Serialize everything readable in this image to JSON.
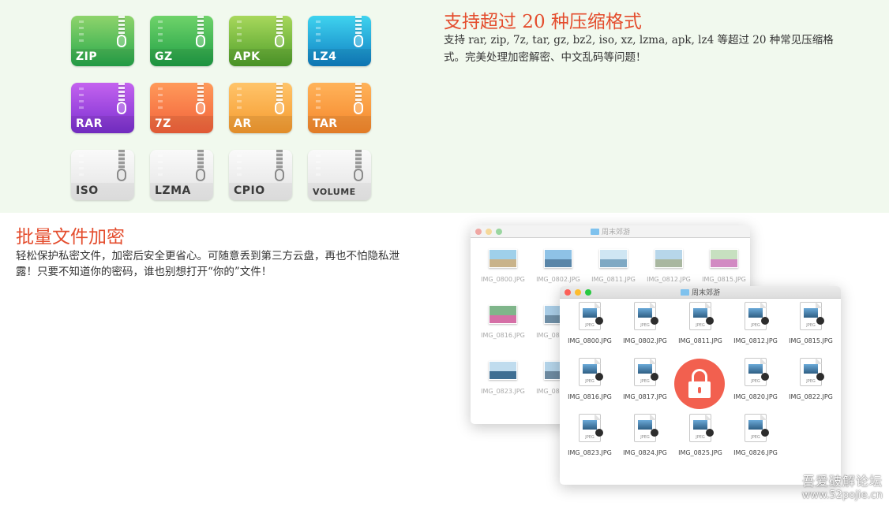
{
  "formats_section": {
    "title": "支持超过 20 种压缩格式",
    "description_line1": "支持 rar, zip, 7z, tar, gz, bz2, iso, xz, lzma, apk, lz4 等超过 20 种常见压缩格",
    "description_line2": "式。完美处理加密解密、中文乱码等问题！"
  },
  "format_icons": [
    {
      "label": "ZIP",
      "color_top": "#8fd46c",
      "color_bottom": "#26a84b"
    },
    {
      "label": "GZ",
      "color_top": "#6fd36a",
      "color_bottom": "#1f9f45"
    },
    {
      "label": "APK",
      "color_top": "#a8d85c",
      "color_bottom": "#4f9f2a"
    },
    {
      "label": "LZ4",
      "color_top": "#3fd3ef",
      "color_bottom": "#0f7fc2"
    },
    {
      "label": "RAR",
      "color_top": "#c463ef",
      "color_bottom": "#7a2fd0"
    },
    {
      "label": "7Z",
      "color_top": "#ff9a5a",
      "color_bottom": "#f2613a"
    },
    {
      "label": "AR",
      "color_top": "#ffc46a",
      "color_bottom": "#f59a2e"
    },
    {
      "label": "TAR",
      "color_top": "#ffb35a",
      "color_bottom": "#f5862a"
    },
    {
      "label": "ISO",
      "color_top": "#fafafa",
      "color_bottom": "#e3e3e3"
    },
    {
      "label": "LZMA",
      "color_top": "#fafafa",
      "color_bottom": "#e3e3e3"
    },
    {
      "label": "CPIO",
      "color_top": "#fafafa",
      "color_bottom": "#e3e3e3"
    },
    {
      "label": "VOLUME",
      "color_top": "#fafafa",
      "color_bottom": "#e3e3e3"
    }
  ],
  "encrypt_section": {
    "title": "批量文件加密",
    "description_line1": "轻松保护私密文件，加密后安全更省心。可随意丢到第三方云盘，再也不怕隐私泄",
    "description_line2": "露！只要不知道你的密码，谁也别想打开“你的”文件！"
  },
  "back_window": {
    "title": "周末郊游",
    "files": [
      {
        "name": "IMG_0800.JPG",
        "sky": "#9fd0ea",
        "ground": "#c9b38a"
      },
      {
        "name": "IMG_0802.JPG",
        "sky": "#8ec2e6",
        "ground": "#5a86a8"
      },
      {
        "name": "IMG_0811.JPG",
        "sky": "#cfe6f3",
        "ground": "#7fa9c4"
      },
      {
        "name": "IMG_0812.JPG",
        "sky": "#b7d6ea",
        "ground": "#a9b7a0"
      },
      {
        "name": "IMG_0815.JPG",
        "sky": "#c7e0c0",
        "ground": "#d28ac3"
      },
      {
        "name": "IMG_0816.JPG",
        "sky": "#7fb58a",
        "ground": "#d56fa6"
      },
      {
        "name": "IMG_0817.JPG",
        "sky": "#a9cde6",
        "ground": "#6f8fa6"
      },
      {
        "name": "IMG_0823.JPG",
        "sky": "#c0dcee",
        "ground": "#3f6f93"
      },
      {
        "name": "IMG_0824.JPG",
        "sky": "#b3d3e8",
        "ground": "#6d8aa0"
      }
    ]
  },
  "front_window": {
    "title": "周末郊游",
    "file_type_label": "JPEG",
    "files": [
      "IMG_0800.JPG",
      "IMG_0802.JPG",
      "IMG_0811.JPG",
      "IMG_0812.JPG",
      "IMG_0815.JPG",
      "IMG_0816.JPG",
      "IMG_0817.JPG",
      "IMG_0820.JPG",
      "IMG_0822.JPG",
      "IMG_0823.JPG",
      "IMG_0824.JPG",
      "IMG_0825.JPG",
      "IMG_0826.JPG"
    ]
  },
  "lock_overlay": {
    "icon": "lock-icon",
    "color": "#f2604f"
  },
  "window_controls": {
    "close": "#fc5f57",
    "minimize": "#fdbc2e",
    "zoom": "#28c840"
  },
  "watermark": {
    "line1": "吾爱破解论坛",
    "line2": "www.52pojie.cn"
  },
  "colors": {
    "accent_title": "#e44d2e",
    "top_band": "#f1f9ee"
  }
}
